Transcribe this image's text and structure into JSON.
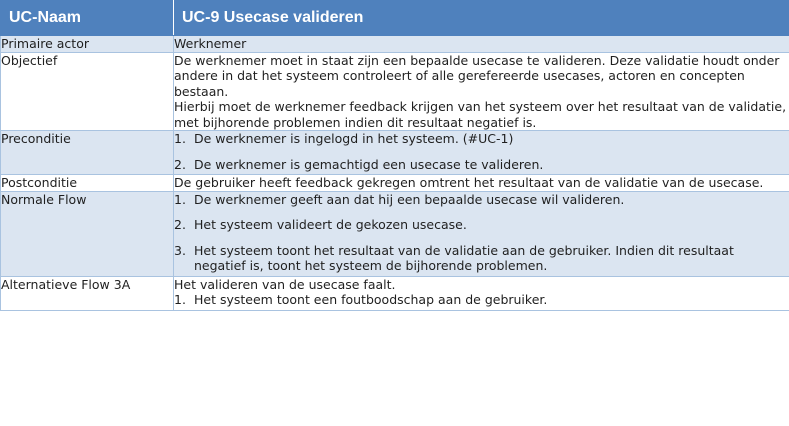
{
  "header": {
    "col1": "UC-Naam",
    "col2": "UC-9 Usecase valideren"
  },
  "rows": [
    {
      "label": "Primaire actor",
      "text": "Werknemer"
    },
    {
      "label": "Objectief",
      "text": "De werknemer moet in staat zijn een bepaalde usecase te valideren. Deze validatie houdt onder andere in dat het systeem controleert of alle gerefereerde usecases, actoren en concepten bestaan.",
      "text2": "Hierbij moet de werknemer feedback krijgen van het systeem over het resultaat van de validatie, met bijhorende problemen indien dit resultaat negatief is."
    },
    {
      "label": "Preconditie",
      "items": [
        {
          "num": "1.",
          "text": "De werknemer is ingelogd in het systeem. (#UC-1)"
        },
        {
          "num": "2.",
          "text": "De werknemer is gemachtigd een usecase te valideren."
        }
      ]
    },
    {
      "label": "Postconditie",
      "text": "De gebruiker heeft feedback gekregen omtrent het resultaat van de validatie van de usecase."
    },
    {
      "label": "Normale Flow",
      "items": [
        {
          "num": "1.",
          "text": "De werknemer geeft aan dat hij een bepaalde usecase wil valideren."
        },
        {
          "num": "2.",
          "text": "Het systeem valideert de gekozen usecase."
        },
        {
          "num": "3.",
          "text": "Het systeem toont het resultaat van de validatie aan de gebruiker. Indien dit resultaat negatief is, toont het systeem de bijhorende problemen."
        }
      ]
    },
    {
      "label": "Alternatieve Flow 3A",
      "text": "Het valideren van de usecase faalt.",
      "items": [
        {
          "num": "1.",
          "text": "Het systeem toont een foutboodschap aan de gebruiker."
        }
      ]
    }
  ],
  "colors": {
    "header_bg": "#4f81bd",
    "alt_row_bg": "#dbe5f1",
    "border": "#a9c3e0"
  }
}
